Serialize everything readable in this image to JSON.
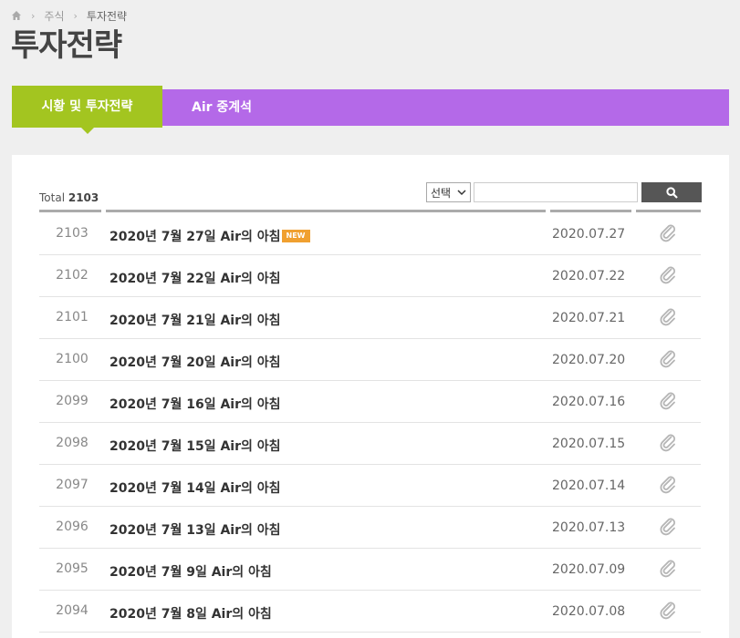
{
  "breadcrumb": {
    "home_icon": "home-icon",
    "items": [
      "주식",
      "투자전략"
    ]
  },
  "page_title": "투자전략",
  "tabs": [
    {
      "label": "시황 및 투자전략",
      "active": true
    },
    {
      "label": "Air 중계석",
      "active": false
    }
  ],
  "colors": {
    "tab_active": "#a3c520",
    "tab_bar": "#b469e8",
    "new_badge": "#f0a030"
  },
  "board": {
    "total_label": "Total",
    "total_count": "2103",
    "search": {
      "select_value": "선택",
      "input_value": "",
      "button_icon": "search-icon"
    },
    "rows": [
      {
        "num": "2103",
        "title": "2020년 7월 27일 Air의 아침",
        "new": true,
        "date": "2020.07.27",
        "attachment_icon": "paperclip-icon"
      },
      {
        "num": "2102",
        "title": "2020년 7월 22일 Air의 아침",
        "new": false,
        "date": "2020.07.22",
        "attachment_icon": "paperclip-icon"
      },
      {
        "num": "2101",
        "title": "2020년 7월 21일 Air의 아침",
        "new": false,
        "date": "2020.07.21",
        "attachment_icon": "paperclip-icon"
      },
      {
        "num": "2100",
        "title": "2020년 7월 20일 Air의 아침",
        "new": false,
        "date": "2020.07.20",
        "attachment_icon": "paperclip-icon"
      },
      {
        "num": "2099",
        "title": "2020년 7월 16일 Air의 아침",
        "new": false,
        "date": "2020.07.16",
        "attachment_icon": "paperclip-icon"
      },
      {
        "num": "2098",
        "title": "2020년 7월 15일 Air의 아침",
        "new": false,
        "date": "2020.07.15",
        "attachment_icon": "paperclip-icon"
      },
      {
        "num": "2097",
        "title": "2020년 7월 14일 Air의 아침",
        "new": false,
        "date": "2020.07.14",
        "attachment_icon": "paperclip-icon"
      },
      {
        "num": "2096",
        "title": "2020년 7월 13일 Air의 아침",
        "new": false,
        "date": "2020.07.13",
        "attachment_icon": "paperclip-icon"
      },
      {
        "num": "2095",
        "title": "2020년 7월 9일 Air의 아침",
        "new": false,
        "date": "2020.07.09",
        "attachment_icon": "paperclip-icon"
      },
      {
        "num": "2094",
        "title": "2020년 7월 8일 Air의 아침",
        "new": false,
        "date": "2020.07.08",
        "attachment_icon": "paperclip-icon"
      }
    ],
    "new_badge_label": "NEW"
  }
}
